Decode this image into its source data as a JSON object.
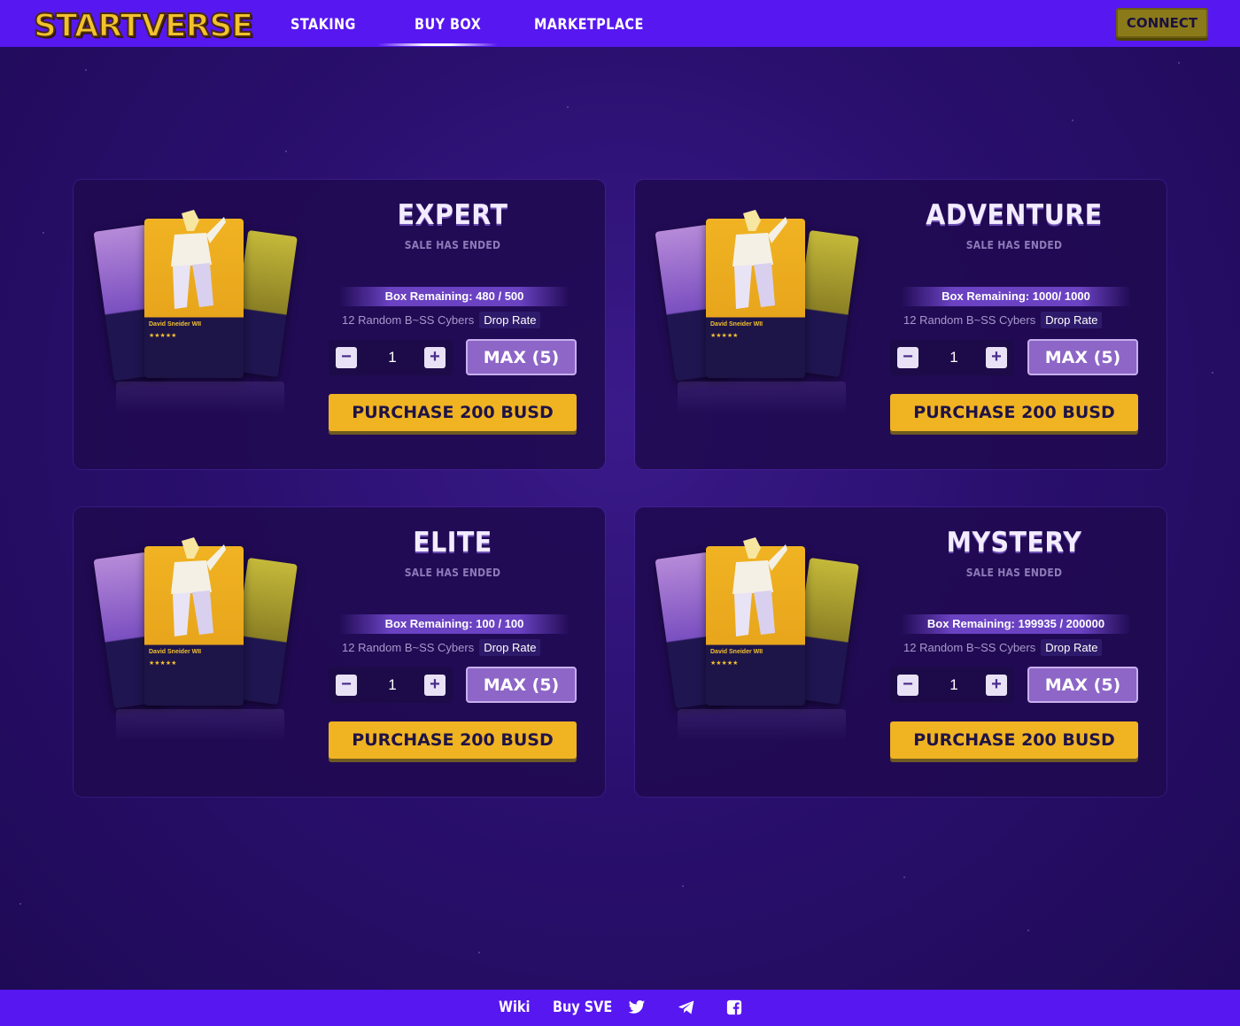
{
  "header": {
    "logo_text": "STARTVERSE",
    "nav": [
      {
        "label": "STAKING"
      },
      {
        "label": "BUY BOX"
      },
      {
        "label": "MARKETPLACE"
      }
    ],
    "connect_label": "CONNECT"
  },
  "boxes": [
    {
      "title": "EXPERT",
      "status": "SALE HAS ENDED",
      "remaining": "Box Remaining: 480 / 500",
      "contents": "12 Random B~SS Cybers",
      "drop_rate_label": "Drop Rate",
      "quantity": "1",
      "max_label": "MAX (5)",
      "purchase_label": "PURCHASE 200 BUSD",
      "art_name": "David Sneider WII"
    },
    {
      "title": "ADVENTURE",
      "status": "SALE HAS ENDED",
      "remaining": "Box Remaining: 1000/ 1000",
      "contents": "12 Random B~SS Cybers",
      "drop_rate_label": "Drop Rate",
      "quantity": "1",
      "max_label": "MAX (5)",
      "purchase_label": "PURCHASE 200 BUSD",
      "art_name": "David Sneider WII"
    },
    {
      "title": "ELITE",
      "status": "SALE HAS ENDED",
      "remaining": "Box Remaining: 100 / 100",
      "contents": "12 Random B~SS Cybers",
      "drop_rate_label": "Drop Rate",
      "quantity": "1",
      "max_label": "MAX (5)",
      "purchase_label": "PURCHASE 200 BUSD",
      "art_name": "David Sneider WII"
    },
    {
      "title": "MYSTERY",
      "status": "SALE HAS ENDED",
      "remaining": "Box Remaining: 199935 / 200000",
      "contents": "12 Random B~SS Cybers",
      "drop_rate_label": "Drop Rate",
      "quantity": "1",
      "max_label": "MAX (5)",
      "purchase_label": "PURCHASE 200 BUSD",
      "art_name": "David Sneider WII"
    }
  ],
  "footer": {
    "links": [
      {
        "label": "Wiki"
      },
      {
        "label": "Buy SVE"
      }
    ],
    "icons": [
      "twitter-icon",
      "telegram-icon",
      "facebook-icon"
    ]
  },
  "colors": {
    "nav_bar": "#5717f0",
    "accent_yellow": "#f0b322",
    "max_button": "#8d66c7",
    "background": "#2a0f6e"
  }
}
